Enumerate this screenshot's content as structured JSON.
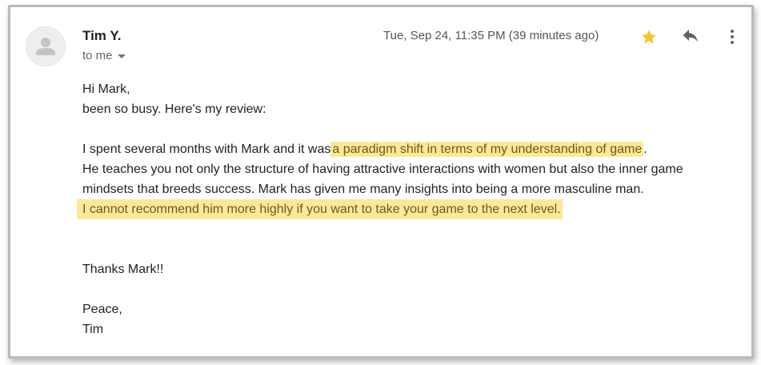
{
  "email": {
    "sender": "Tim Y.",
    "recipient_label": "to me",
    "timestamp": "Tue, Sep 24, 11:35 PM (39 minutes ago)",
    "icons": {
      "avatar": "person-icon",
      "recipient_toggle": "chevron-down-icon",
      "star": "star-icon",
      "reply": "reply-icon",
      "more": "more-vert-icon"
    },
    "colors": {
      "star": "#f4c430",
      "highlight": "#fde89a",
      "highlight_text": "#6d5a15"
    },
    "body": {
      "greeting": "Hi Mark,",
      "line2": "been so busy.  Here's my review:",
      "p3_before": "I spent several months with Mark and it was",
      "p3_highlight": "a paradigm shift in terms of my understanding of game",
      "p3_after": ".",
      "line4": "He teaches you not only the structure of having attractive interactions with women but also the inner game",
      "line5": "mindsets that breeds success.  Mark has given me many insights into being a more masculine man.",
      "line6_highlight": "I cannot recommend him more highly if you want to take your game to the next level.",
      "thanks": "Thanks Mark!!",
      "signoff": "Peace,",
      "signature": "Tim"
    }
  }
}
